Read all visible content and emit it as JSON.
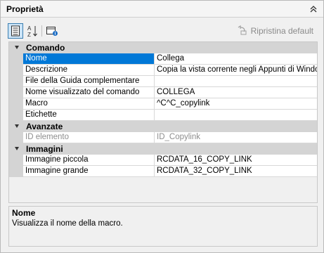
{
  "panel": {
    "title": "Proprietà",
    "collapse_icon": "double-chevron-up-icon"
  },
  "toolbar": {
    "categorized_icon": "categorized-list-icon",
    "alphabetical_icon": "sort-az-icon",
    "pages_icon": "property-pages-icon",
    "reset_label": "Ripristina default",
    "reset_icon": "reset-icon"
  },
  "grid": {
    "categories": [
      {
        "label": "Comando",
        "expanded": true,
        "properties": [
          {
            "name": "Nome",
            "value": "Collega",
            "selected": true
          },
          {
            "name": "Descrizione",
            "value": "Copia la vista corrente negli Appunti di Windows"
          },
          {
            "name": "File della Guida complementare",
            "value": ""
          },
          {
            "name": "Nome visualizzato del comando",
            "value": "COLLEGA"
          },
          {
            "name": "Macro",
            "value": "^C^C_copylink"
          },
          {
            "name": "Etichette",
            "value": ""
          }
        ]
      },
      {
        "label": "Avanzate",
        "expanded": true,
        "properties": [
          {
            "name": "ID elemento",
            "value": "ID_Copylink",
            "readonly": true
          }
        ]
      },
      {
        "label": "Immagini",
        "expanded": true,
        "properties": [
          {
            "name": "Immagine piccola",
            "value": "RCDATA_16_COPY_LINK"
          },
          {
            "name": "Immagine grande",
            "value": "RCDATA_32_COPY_LINK"
          }
        ]
      }
    ]
  },
  "description": {
    "title": "Nome",
    "text": "Visualizza il nome della macro."
  },
  "colors": {
    "selection": "#0078d7",
    "category_bg": "#d4d4d4",
    "readonly_text": "#8d8d8d"
  }
}
